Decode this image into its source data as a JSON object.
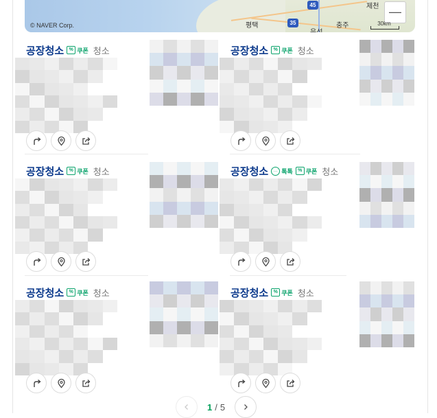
{
  "map": {
    "copyright": "© NAVER Corp.",
    "places": [
      "평택",
      "음성",
      "충주",
      "제천"
    ],
    "highways": [
      "45",
      "35"
    ],
    "zoom_out_label": "—",
    "scale_label": "30km"
  },
  "cards": [
    {
      "name": "공장청소",
      "badges": {
        "talk": false,
        "coupon": true
      },
      "category": "청소"
    },
    {
      "name": "공장청소",
      "badges": {
        "talk": false,
        "coupon": true
      },
      "category": "청소"
    },
    {
      "name": "공장청소",
      "badges": {
        "talk": false,
        "coupon": true
      },
      "category": "청소"
    },
    {
      "name": "공장청소",
      "badges": {
        "talk": true,
        "coupon": true
      },
      "category": "청소"
    },
    {
      "name": "공장청소",
      "badges": {
        "talk": false,
        "coupon": true
      },
      "category": "청소"
    },
    {
      "name": "공장청소",
      "badges": {
        "talk": false,
        "coupon": true
      },
      "category": "청소"
    }
  ],
  "badge_labels": {
    "coupon": "쿠폰",
    "talk": "톡톡"
  },
  "actions": [
    "directions-icon",
    "map-pin-icon",
    "share-icon"
  ],
  "pagination": {
    "current": "1",
    "separator": "/",
    "total": "5"
  },
  "colors": {
    "title": "#0c3a8c",
    "badge": "#0aa36b",
    "page_current": "#03a05b"
  }
}
